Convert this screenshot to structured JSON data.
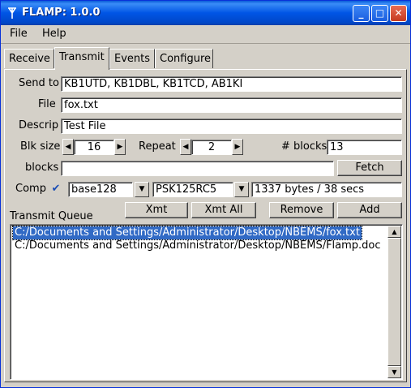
{
  "window": {
    "title": "FLAMP: 1.0.0",
    "minimize": "_",
    "maximize": "□",
    "close": "✕"
  },
  "menu": {
    "file": "File",
    "help": "Help"
  },
  "tabs": [
    {
      "label": "Receive"
    },
    {
      "label": "Transmit",
      "active": true
    },
    {
      "label": "Events"
    },
    {
      "label": "Configure"
    }
  ],
  "form": {
    "send_to_label": "Send to",
    "send_to_value": "KB1UTD, KB1DBL, KB1TCD, AB1KI",
    "file_label": "File",
    "file_value": "fox.txt",
    "descrip_label": "Descrip",
    "descrip_value": "Test File",
    "blk_size_label": "Blk size",
    "blk_size_value": "16",
    "repeat_label": "Repeat",
    "repeat_value": "2",
    "nblocks_label": "# blocks",
    "nblocks_value": "13",
    "blocks_label": "blocks",
    "blocks_value": "",
    "fetch_label": "Fetch",
    "comp_label": "Comp",
    "comp_checked": true,
    "encoding_value": "base128",
    "mode_value": "PSK125RC5",
    "size_info": "1337 bytes / 38 secs"
  },
  "queue": {
    "label": "Transmit Queue",
    "xmt": "Xmt",
    "xmt_all": "Xmt All",
    "remove": "Remove",
    "add": "Add",
    "items": [
      "C:/Documents and Settings/Administrator/Desktop/NBEMS/fox.txt",
      "C:/Documents and Settings/Administrator/Desktop/NBEMS/Flamp.doc"
    ],
    "selected_index": 0
  },
  "colors": {
    "title_bar": "#0055e5",
    "selection": "#316ac5",
    "face": "#d4d0c8"
  },
  "icons": {
    "app": "antenna-icon",
    "check": "checkmark-icon"
  }
}
